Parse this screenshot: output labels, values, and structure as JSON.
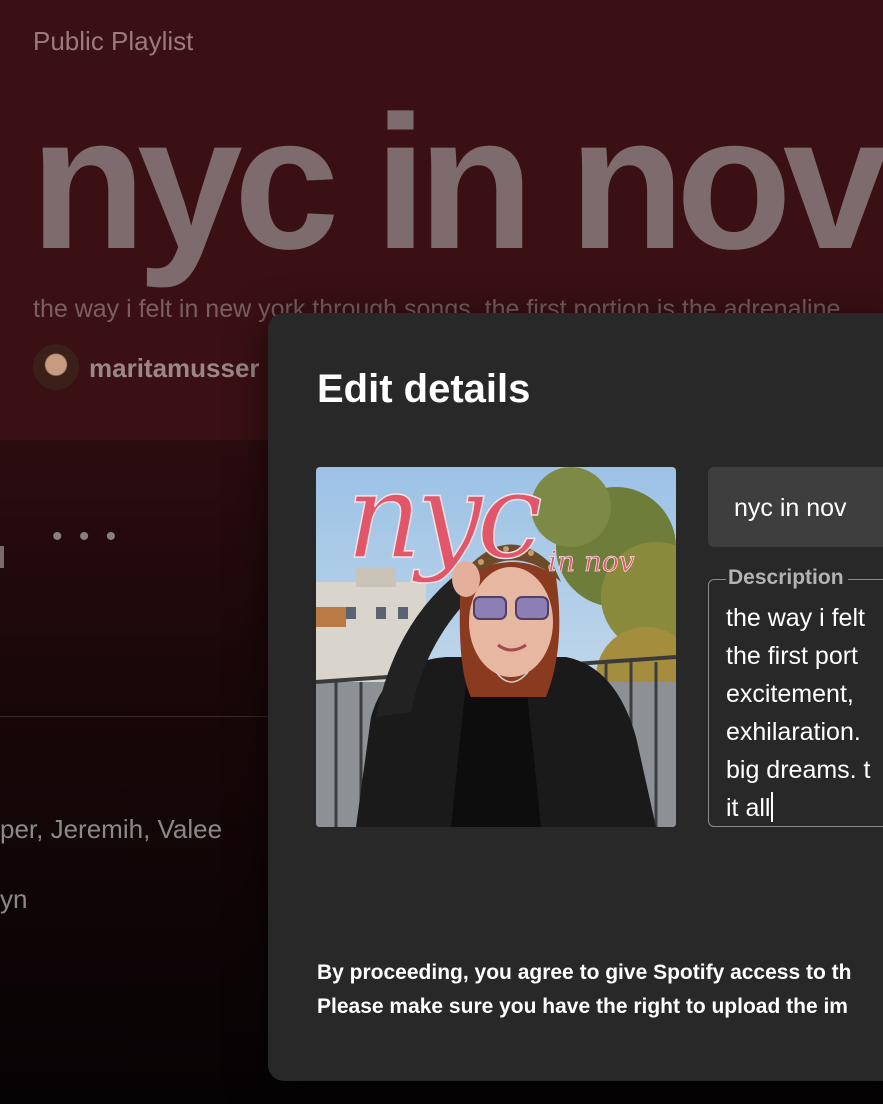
{
  "colors": {
    "header_bg": "#3a1014",
    "modal_bg": "#282828",
    "field_bg": "#3e3e3e",
    "cover_title": "#e2566a"
  },
  "playlist": {
    "type": "Public Playlist",
    "title": "nyc in nov",
    "description": "the way i felt in new york through songs. the first portion is the adrenaline",
    "owner": "maritamusser"
  },
  "controls": {
    "more_icon": "more-horizontal-icon",
    "more": "• • •"
  },
  "tracks": [
    {
      "artists": "per, Jeremih, Valee"
    },
    {
      "artists": "yn"
    }
  ],
  "modal": {
    "title": "Edit details",
    "cover": {
      "script_text": "nyc",
      "subtitle": "in nov"
    },
    "name_value": "nyc in nov",
    "description_label": "Description",
    "description_lines": [
      "the way i felt",
      "the first port",
      "excitement,",
      "exhilaration.",
      "big dreams. t",
      "it all"
    ],
    "legal_lines": [
      "By proceeding, you agree to give Spotify access to th",
      "Please make sure you have the right to upload the im"
    ]
  }
}
